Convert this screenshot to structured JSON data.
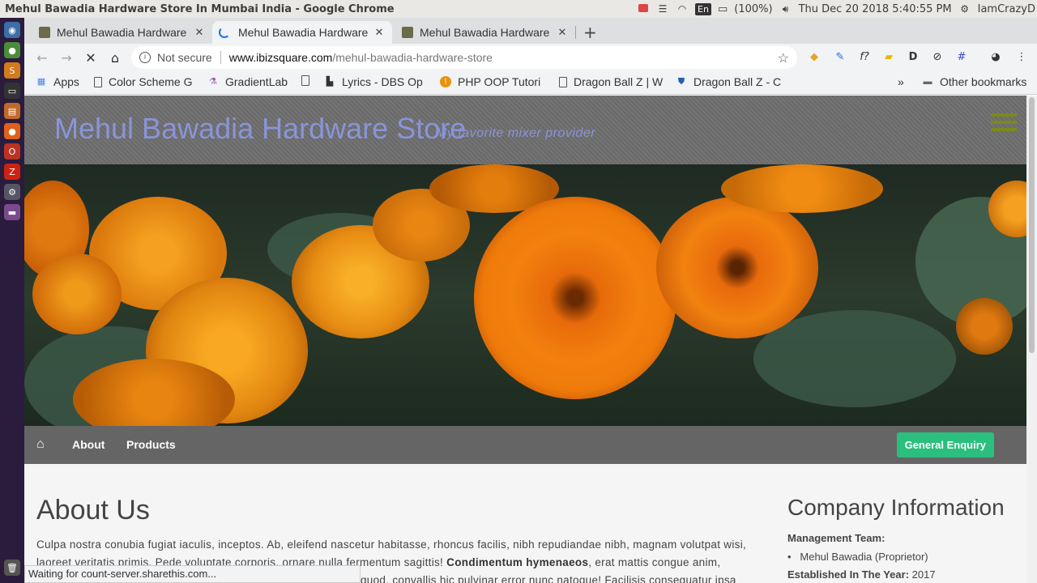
{
  "os": {
    "window_title": "Mehul Bawadia Hardware Store In Mumbai India - Google Chrome",
    "battery": "(100%)",
    "lang": "En",
    "datetime": "Thu Dec 20 2018  5:40:55 PM",
    "user": "IamCrazyD"
  },
  "tabs": [
    {
      "label": "Mehul Bawadia Hardware",
      "active": false
    },
    {
      "label": "Mehul Bawadia Hardware",
      "active": true
    },
    {
      "label": "Mehul Bawadia Hardware",
      "active": false
    }
  ],
  "omnibox": {
    "security": "Not secure",
    "host": "www.ibizsquare.com",
    "path": "/mehul-bawadia-hardware-store"
  },
  "bookmarks": [
    {
      "label": "Apps"
    },
    {
      "label": "Color Scheme G"
    },
    {
      "label": "GradientLab"
    },
    {
      "label": "Lyrics - DBS Op"
    },
    {
      "label": "PHP OOP Tutori"
    },
    {
      "label": "Dragon Ball Z | W"
    },
    {
      "label": "Dragon Ball Z - C"
    },
    {
      "label": "Other bookmarks"
    }
  ],
  "site": {
    "brand": "Mehul Bawadia Hardware Store",
    "tagline": "My favorite mixer provider",
    "nav": {
      "about": "About",
      "products": "Products",
      "enquiry": "General Enquiry"
    },
    "about_title": "About Us",
    "about_line1": "Culpa nostra conubia fugiat iaculis, inceptos. Ab, eleifend nascetur habitasse, rhoncus facilis, nibh repudiandae nibh, magnam volutpat wisi,",
    "about_line2a": "laoreet veritatis primis. Pede voluptate corporis, ornare nulla fermentum sagittis! ",
    "about_line2b": "Condimentum hymenaeos",
    "about_line2c": ", erat mattis congue anim,",
    "about_line3": "quod, convallis hic pulvinar error nunc natoque! Facilisis consequatur ipsa nobis",
    "company_title": "Company Information",
    "management_label": "Management Team:",
    "management_item": "Mehul Bawadia (Proprietor)",
    "established_label": "Established In The Year:",
    "established_value": "2017"
  },
  "status": "Waiting for count-server.sharethis.com..."
}
